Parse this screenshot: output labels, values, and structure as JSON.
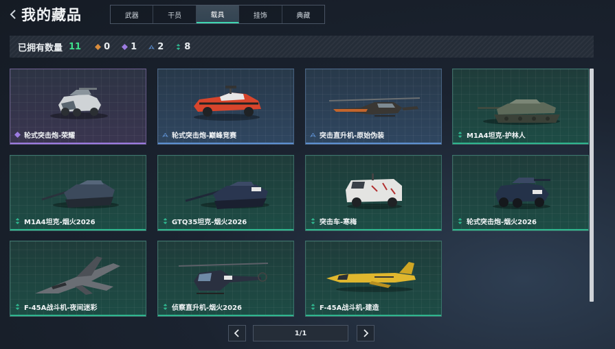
{
  "header": {
    "title": "我的藏品",
    "tabs": [
      {
        "label": "武器",
        "active": false
      },
      {
        "label": "干员",
        "active": false
      },
      {
        "label": "载具",
        "active": true
      },
      {
        "label": "挂饰",
        "active": false
      },
      {
        "label": "典藏",
        "active": false
      }
    ]
  },
  "summary": {
    "owned_label": "已拥有数量",
    "owned_count": "11",
    "rarity_counts": [
      {
        "icon": "orange-diamond-icon",
        "color": "#d98c3c",
        "count": "0"
      },
      {
        "icon": "purple-diamond-icon",
        "color": "#9c7be0",
        "count": "1"
      },
      {
        "icon": "blue-diamond-icon",
        "color": "#5d8fd0",
        "count": "2"
      },
      {
        "icon": "green-diamond-icon",
        "color": "#2fb58e",
        "count": "8"
      }
    ]
  },
  "items": [
    {
      "name": "轮式突击炮-荣耀",
      "rarity": "purple",
      "vehicle": "armored-car"
    },
    {
      "name": "轮式突击炮-巅峰竞赛",
      "rarity": "blue",
      "vehicle": "armored-car-red"
    },
    {
      "name": "突击直升机-原始伪装",
      "rarity": "blue",
      "vehicle": "attack-helicopter"
    },
    {
      "name": "M1A4坦克-护林人",
      "rarity": "green",
      "vehicle": "tank-camo"
    },
    {
      "name": "M1A4坦克-烟火2026",
      "rarity": "green",
      "vehicle": "tank-dark"
    },
    {
      "name": "GTQ35坦克-烟火2026",
      "rarity": "green",
      "vehicle": "tank-navy"
    },
    {
      "name": "突击车-寒梅",
      "rarity": "green",
      "vehicle": "assault-vehicle"
    },
    {
      "name": "轮式突击炮-烟火2026",
      "rarity": "green",
      "vehicle": "armored-car-navy"
    },
    {
      "name": "F-45A战斗机-夜间迷彩",
      "rarity": "green",
      "vehicle": "fighter-jet-camo"
    },
    {
      "name": "侦察直升机-烟火2026",
      "rarity": "green",
      "vehicle": "scout-helicopter"
    },
    {
      "name": "F-45A战斗机-建造",
      "rarity": "green",
      "vehicle": "fighter-jet-yellow"
    }
  ],
  "rarity_colors": {
    "purple": "#9c7be0",
    "blue": "#5d8fd0",
    "green": "#2fb58e"
  },
  "pagination": {
    "page_text": "1/1",
    "prev_icon": "chevron-left-icon",
    "next_icon": "chevron-right-icon"
  }
}
